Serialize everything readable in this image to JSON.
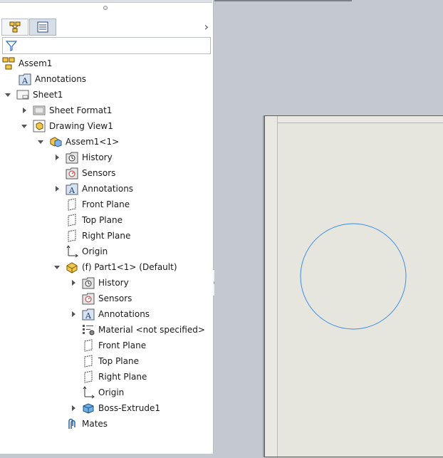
{
  "tree": {
    "root": "Assem1",
    "items": [
      {
        "label": "Annotations"
      },
      {
        "label": "Sheet1"
      },
      {
        "label": "Sheet Format1"
      },
      {
        "label": "Drawing View1"
      },
      {
        "label": "Assem1<1>"
      },
      {
        "label": "History"
      },
      {
        "label": "Sensors"
      },
      {
        "label": "Annotations"
      },
      {
        "label": "Front Plane"
      },
      {
        "label": "Top Plane"
      },
      {
        "label": "Right Plane"
      },
      {
        "label": "Origin"
      },
      {
        "label": "(f) Part1<1> (Default)"
      },
      {
        "label": "History"
      },
      {
        "label": "Sensors"
      },
      {
        "label": "Annotations"
      },
      {
        "label": "Material <not specified>"
      },
      {
        "label": "Front Plane"
      },
      {
        "label": "Top Plane"
      },
      {
        "label": "Right Plane"
      },
      {
        "label": "Origin"
      },
      {
        "label": "Boss-Extrude1"
      },
      {
        "label": "Mates"
      }
    ]
  },
  "colors": {
    "accent": "#2a7de1",
    "circle": "#3a8ee6",
    "sheet": "#e6e5de"
  }
}
